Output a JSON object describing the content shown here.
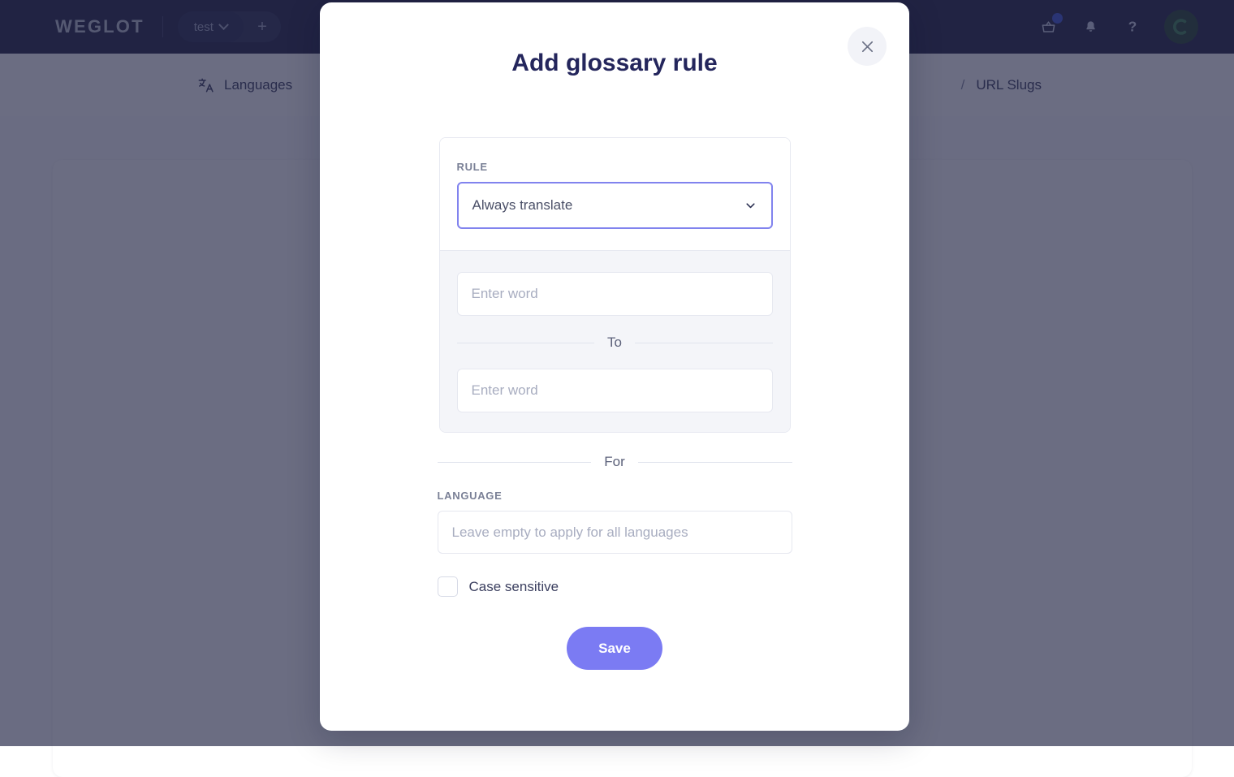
{
  "topbar": {
    "brand": "WEGLOT",
    "project_name": "test",
    "add_project_label": "+",
    "icons": {
      "cart": "shopping-basket-icon",
      "notifications": "bell-icon",
      "help": "question-mark-icon",
      "avatar": "user-avatar"
    }
  },
  "subnav": {
    "languages_label": "Languages",
    "separator": "/",
    "url_slugs_label": "URL Slugs"
  },
  "modal": {
    "title": "Add glossary rule",
    "close_label": "×",
    "rule": {
      "label": "RULE",
      "selected_option": "Always translate"
    },
    "source_word": {
      "value": "",
      "placeholder": "Enter word"
    },
    "to_divider": "To",
    "target_word": {
      "value": "",
      "placeholder": "Enter word"
    },
    "for_divider": "For",
    "language": {
      "label": "LANGUAGE",
      "value": "",
      "placeholder": "Leave empty to apply for all languages"
    },
    "case_sensitive": {
      "label": "Case sensitive",
      "checked": false
    },
    "save_label": "Save"
  },
  "colors": {
    "topbar_bg": "#111336",
    "accent_purple": "#7b7bf3",
    "select_border": "#8183ee",
    "title_navy": "#24265c",
    "panel_bg": "#f4f5f9",
    "badge_blue": "#2f49d1",
    "avatar_green": "#16361f"
  }
}
